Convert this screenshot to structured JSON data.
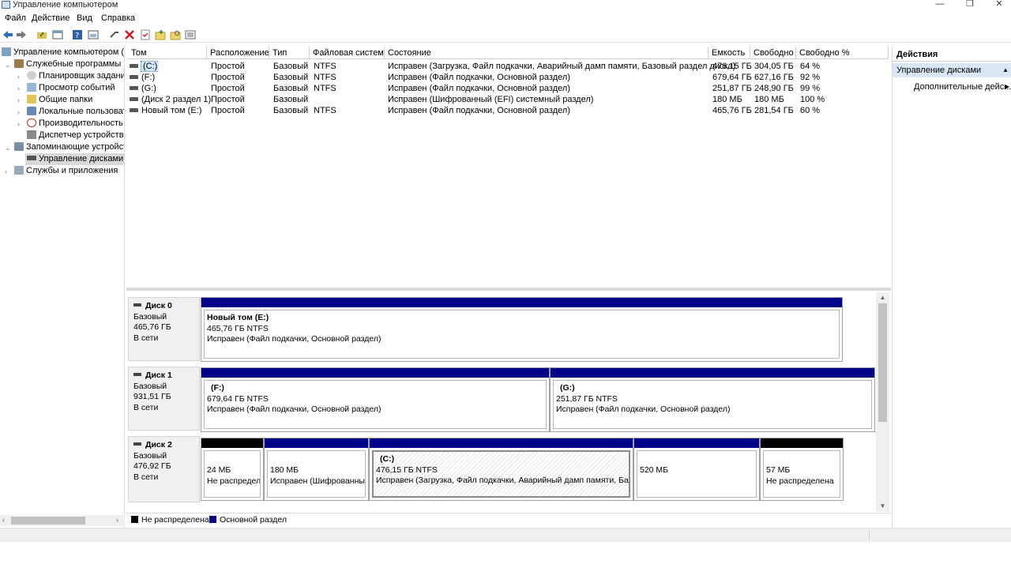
{
  "window": {
    "title": "Управление компьютером",
    "minimize": "—",
    "restore": "❐",
    "close": "✕"
  },
  "menu": [
    "Файл",
    "Действие",
    "Вид",
    "Справка"
  ],
  "tree": {
    "root": "Управление компьютером (лс",
    "system_tools": "Служебные программы",
    "task_scheduler": "Планировщик заданий",
    "event_viewer": "Просмотр событий",
    "shared_folders": "Общие папки",
    "local_users": "Локальные пользовате",
    "performance": "Производительность",
    "device_manager": "Диспетчер устройств",
    "storage": "Запоминающие устройств",
    "disk_management": "Управление дисками",
    "services": "Службы и приложения"
  },
  "volume_list": {
    "headers": [
      "Том",
      "Расположение",
      "Тип",
      "Файловая система",
      "Состояние",
      "Емкость",
      "Свободно",
      "Свободно %"
    ],
    "rows": [
      [
        "(C:)",
        "Простой",
        "Базовый",
        "NTFS",
        "Исправен (Загрузка, Файл подкачки, Аварийный дамп памяти, Базовый раздел диска)",
        "476,15 ГБ",
        "304,05 ГБ",
        "64 %"
      ],
      [
        "(F:)",
        "Простой",
        "Базовый",
        "NTFS",
        "Исправен (Файл подкачки, Основной раздел)",
        "679,64 ГБ",
        "627,16 ГБ",
        "92 %"
      ],
      [
        "(G:)",
        "Простой",
        "Базовый",
        "NTFS",
        "Исправен (Файл подкачки, Основной раздел)",
        "251,87 ГБ",
        "248,90 ГБ",
        "99 %"
      ],
      [
        "(Диск 2 раздел 1)",
        "Простой",
        "Базовый",
        "",
        "Исправен (Шифрованный (EFI) системный раздел)",
        "180 МБ",
        "180 МБ",
        "100 %"
      ],
      [
        "Новый том (E:)",
        "Простой",
        "Базовый",
        "NTFS",
        "Исправен (Файл подкачки, Основной раздел)",
        "465,76 ГБ",
        "281,54 ГБ",
        "60 %"
      ]
    ]
  },
  "disks": [
    {
      "name": "Диск 0",
      "type": "Базовый",
      "size": "465,76 ГБ",
      "status": "В сети",
      "partitions": [
        {
          "name": "Новый том  (E:)",
          "size": "465,76 ГБ NTFS",
          "status": "Исправен (Файл подкачки, Основной раздел)"
        }
      ]
    },
    {
      "name": "Диск 1",
      "type": "Базовый",
      "size": "931,51 ГБ",
      "status": "В сети",
      "partitions": [
        {
          "name": "(F:)",
          "size": "679,64 ГБ NTFS",
          "status": "Исправен (Файл подкачки, Основной раздел)"
        },
        {
          "name": "(G:)",
          "size": "251,87 ГБ NTFS",
          "status": "Исправен (Файл подкачки, Основной раздел)"
        }
      ]
    },
    {
      "name": "Диск 2",
      "type": "Базовый",
      "size": "476,92 ГБ",
      "status": "В сети",
      "partitions": [
        {
          "name": "",
          "size": "24 МБ",
          "status": "Не распределе"
        },
        {
          "name": "",
          "size": "180 МБ",
          "status": "Исправен (Шифрованный"
        },
        {
          "name": "(C:)",
          "size": "476,15 ГБ NTFS",
          "status": "Исправен (Загрузка, Файл подкачки, Аварийный дамп памяти, Базов"
        },
        {
          "name": "",
          "size": "520 МБ",
          "status": ""
        },
        {
          "name": "",
          "size": "57 МБ",
          "status": "Не распределена"
        }
      ]
    }
  ],
  "legend": {
    "unallocated": "Не распределена",
    "primary": "Основной раздел"
  },
  "actions": {
    "header": "Действия",
    "section": "Управление дисками",
    "more": "Дополнительные дейс..."
  },
  "colors": {
    "primary_partition": "#00008b",
    "unallocated": "#000000",
    "selection": "#cde8ff",
    "actions_section": "#dbe6f4"
  },
  "icons": {
    "back": "back-arrow-icon",
    "forward": "forward-arrow-icon",
    "delete": "red-x-icon"
  }
}
